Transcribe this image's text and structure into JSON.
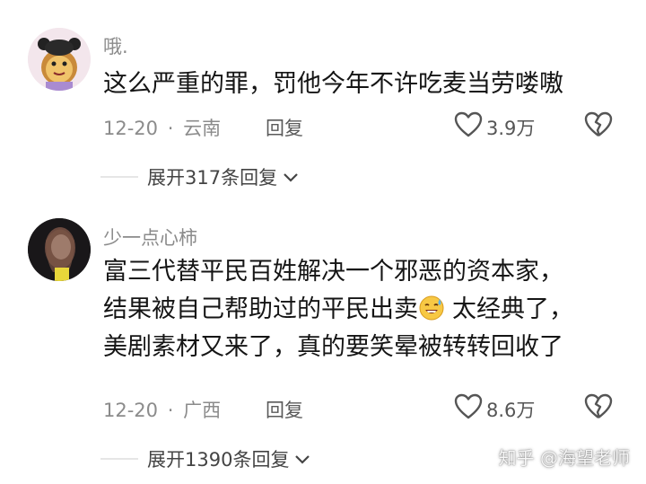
{
  "comments": [
    {
      "username": "哦.",
      "lines": [
        "这么严重的罪，罚他今年不许吃麦当劳喽嗷"
      ],
      "date": "12-20",
      "location": "云南",
      "reply_label": "回复",
      "likes": "3.9万",
      "expand_label": "展开317条回复"
    },
    {
      "username": "少一点心柿",
      "lines": [
        "富三代替平民百姓解决一个邪恶的资本家，",
        "结果被自己帮助过的平民出卖",
        "太经典了，",
        "美剧素材又来了，真的要笑晕被转转回收了"
      ],
      "date": "12-20",
      "location": "广西",
      "reply_label": "回复",
      "likes": "8.6万",
      "expand_label": "展开1390条回复"
    }
  ],
  "separator": "·",
  "watermark": "知乎 @海望老师",
  "icons": {
    "like": "heart-outline-icon",
    "dislike": "broken-heart-icon",
    "expand": "chevron-down-icon",
    "emoji": "sweat-smile-emoji-icon"
  },
  "colors": {
    "text": "#151515",
    "muted": "#8b8b8b",
    "divider": "#e6e6e6"
  }
}
